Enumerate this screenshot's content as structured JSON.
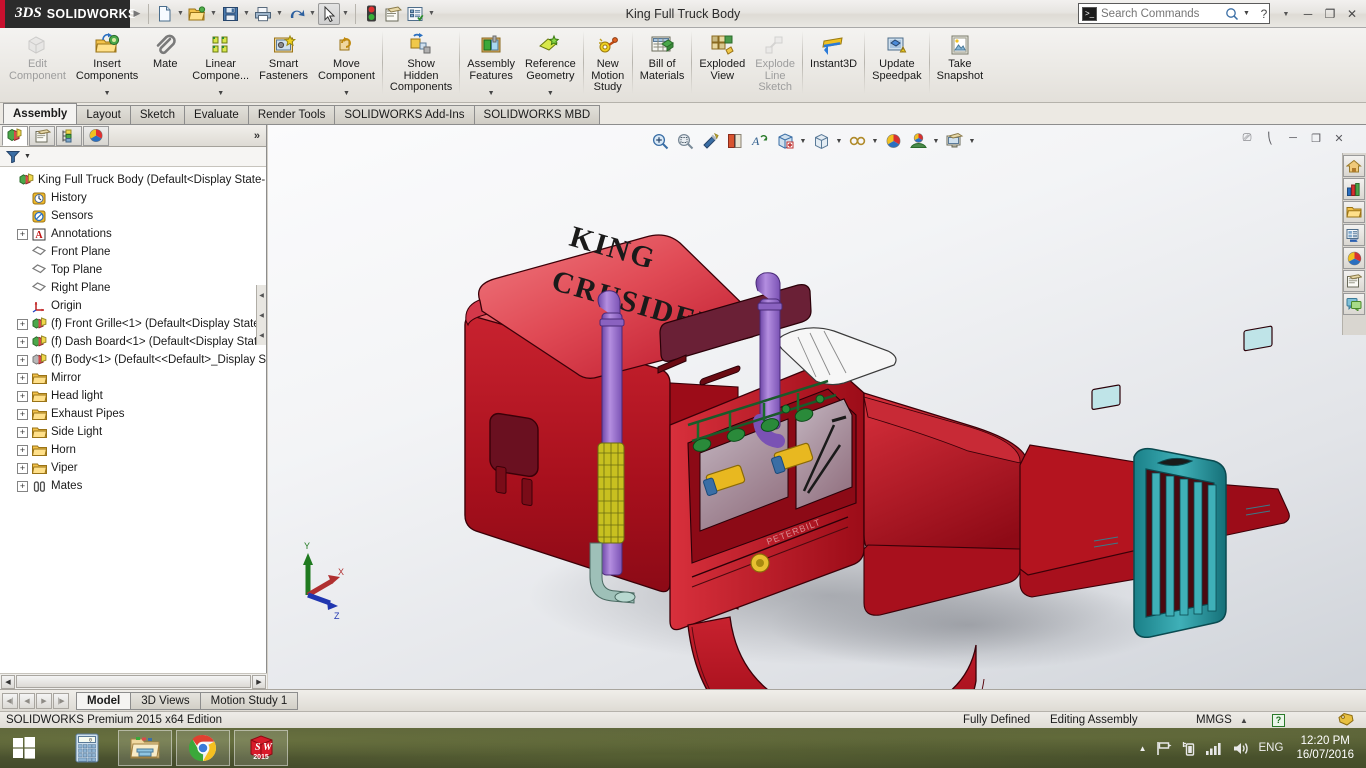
{
  "titlebar": {
    "brand_ds": "3DS",
    "brand_name": "SOLIDWORKS",
    "document_title": "King Full Truck Body",
    "quick_access": [
      {
        "name": "new-document-button",
        "icon": "new-document-icon",
        "dropdown": true
      },
      {
        "name": "open-document-button",
        "icon": "open-folder-icon",
        "dropdown": true
      },
      {
        "name": "save-button",
        "icon": "save-floppy-icon",
        "dropdown": true
      },
      {
        "name": "print-button",
        "icon": "printer-icon",
        "dropdown": true
      },
      {
        "name": "undo-button",
        "icon": "undo-arrow-icon",
        "dropdown": true
      },
      {
        "name": "select-button",
        "icon": "cursor-arrow-icon",
        "dropdown": true
      },
      {
        "name": "rebuild-button",
        "icon": "traffic-light-icon",
        "dropdown": false
      },
      {
        "name": "file-properties-button",
        "icon": "properties-icon",
        "dropdown": false
      },
      {
        "name": "options-button",
        "icon": "options-list-icon",
        "dropdown": true
      }
    ],
    "search": {
      "placeholder": "Search Commands",
      "value": ""
    },
    "help_label": "?",
    "window_controls": [
      "minimize",
      "restore",
      "close"
    ]
  },
  "ribbon": {
    "groups": [
      {
        "buttons": [
          {
            "label": "Edit\nComponent",
            "name": "edit-component-button",
            "icon": "edit-component-icon",
            "disabled": true,
            "dropdown": false
          },
          {
            "label": "Insert\nComponents",
            "name": "insert-components-button",
            "icon": "insert-components-icon",
            "disabled": false,
            "dropdown": true
          },
          {
            "label": "Mate",
            "name": "mate-button",
            "icon": "mate-paperclip-icon",
            "disabled": false,
            "dropdown": false
          },
          {
            "label": "Linear\nCompone...",
            "name": "linear-component-pattern-button",
            "icon": "linear-pattern-icon",
            "disabled": false,
            "dropdown": true
          },
          {
            "label": "Smart\nFasteners",
            "name": "smart-fasteners-button",
            "icon": "smart-fasteners-icon",
            "disabled": false,
            "dropdown": false
          },
          {
            "label": "Move\nComponent",
            "name": "move-component-button",
            "icon": "move-component-icon",
            "disabled": false,
            "dropdown": true
          }
        ]
      },
      {
        "buttons": [
          {
            "label": "Show\nHidden\nComponents",
            "name": "show-hidden-components-button",
            "icon": "show-hidden-icon",
            "disabled": false,
            "dropdown": false
          }
        ]
      },
      {
        "buttons": [
          {
            "label": "Assembly\nFeatures",
            "name": "assembly-features-button",
            "icon": "assembly-features-icon",
            "disabled": false,
            "dropdown": true
          },
          {
            "label": "Reference\nGeometry",
            "name": "reference-geometry-button",
            "icon": "reference-geometry-icon",
            "disabled": false,
            "dropdown": true
          }
        ]
      },
      {
        "buttons": [
          {
            "label": "New\nMotion\nStudy",
            "name": "new-motion-study-button",
            "icon": "motion-study-icon",
            "disabled": false,
            "dropdown": false
          }
        ]
      },
      {
        "buttons": [
          {
            "label": "Bill of\nMaterials",
            "name": "bill-of-materials-button",
            "icon": "bill-of-materials-icon",
            "disabled": false,
            "dropdown": false
          }
        ]
      },
      {
        "buttons": [
          {
            "label": "Exploded\nView",
            "name": "exploded-view-button",
            "icon": "exploded-view-icon",
            "disabled": false,
            "dropdown": false
          },
          {
            "label": "Explode\nLine\nSketch",
            "name": "explode-line-sketch-button",
            "icon": "explode-line-sketch-icon",
            "disabled": true,
            "dropdown": false
          }
        ]
      },
      {
        "buttons": [
          {
            "label": "Instant3D",
            "name": "instant3d-button",
            "icon": "instant3d-icon",
            "disabled": false,
            "dropdown": false
          }
        ]
      },
      {
        "buttons": [
          {
            "label": "Update\nSpeedpak",
            "name": "update-speedpak-button",
            "icon": "update-speedpak-icon",
            "disabled": false,
            "dropdown": false
          }
        ]
      },
      {
        "buttons": [
          {
            "label": "Take\nSnapshot",
            "name": "take-snapshot-button",
            "icon": "take-snapshot-icon",
            "disabled": false,
            "dropdown": false
          }
        ]
      }
    ]
  },
  "command_tabs": [
    {
      "label": "Assembly",
      "active": true
    },
    {
      "label": "Layout",
      "active": false
    },
    {
      "label": "Sketch",
      "active": false
    },
    {
      "label": "Evaluate",
      "active": false
    },
    {
      "label": "Render Tools",
      "active": false
    },
    {
      "label": "SOLIDWORKS Add-Ins",
      "active": false
    },
    {
      "label": "SOLIDWORKS MBD",
      "active": false
    }
  ],
  "feature_manager": {
    "tabs": [
      {
        "name": "feature-manager-tab",
        "icon": "feature-tree-icon",
        "active": true
      },
      {
        "name": "property-manager-tab",
        "icon": "property-manager-icon",
        "active": false
      },
      {
        "name": "configuration-manager-tab",
        "icon": "configuration-manager-icon",
        "active": false
      },
      {
        "name": "display-manager-tab",
        "icon": "display-manager-icon",
        "active": false
      }
    ],
    "overflow_label": "»",
    "filter_placeholder": "",
    "tree": [
      {
        "label": "King Full Truck Body  (Default<Display State-1",
        "indent": 0,
        "expander": "none",
        "icon": "assembly-icon"
      },
      {
        "label": "History",
        "indent": 1,
        "expander": "none",
        "icon": "history-clock-icon"
      },
      {
        "label": "Sensors",
        "indent": 1,
        "expander": "none",
        "icon": "sensors-icon"
      },
      {
        "label": "Annotations",
        "indent": 1,
        "expander": "plus",
        "icon": "annotations-a-icon"
      },
      {
        "label": "Front Plane",
        "indent": 1,
        "expander": "none",
        "icon": "plane-icon"
      },
      {
        "label": "Top Plane",
        "indent": 1,
        "expander": "none",
        "icon": "plane-icon"
      },
      {
        "label": "Right Plane",
        "indent": 1,
        "expander": "none",
        "icon": "plane-icon"
      },
      {
        "label": "Origin",
        "indent": 1,
        "expander": "none",
        "icon": "origin-icon"
      },
      {
        "label": "(f) Front Grille<1>  (Default<Display State-",
        "indent": 1,
        "expander": "plus",
        "icon": "part-icon"
      },
      {
        "label": "(f) Dash Board<1>  (Default<Display State-",
        "indent": 1,
        "expander": "plus",
        "icon": "part-icon"
      },
      {
        "label": "(f) Body<1>  (Default<<Default>_Display S",
        "indent": 1,
        "expander": "plus",
        "icon": "part-gray-icon"
      },
      {
        "label": "Mirror",
        "indent": 1,
        "expander": "plus",
        "icon": "folder-icon"
      },
      {
        "label": "Head light",
        "indent": 1,
        "expander": "plus",
        "icon": "folder-icon"
      },
      {
        "label": "Exhaust Pipes",
        "indent": 1,
        "expander": "plus",
        "icon": "folder-icon"
      },
      {
        "label": "Side Light",
        "indent": 1,
        "expander": "plus",
        "icon": "folder-icon"
      },
      {
        "label": "Horn",
        "indent": 1,
        "expander": "plus",
        "icon": "folder-icon"
      },
      {
        "label": "Viper",
        "indent": 1,
        "expander": "plus",
        "icon": "folder-icon"
      },
      {
        "label": "Mates",
        "indent": 1,
        "expander": "plus",
        "icon": "mates-icon"
      }
    ]
  },
  "view_toolbar": [
    {
      "name": "zoom-to-fit-button",
      "icon": "zoom-to-fit-icon",
      "dropdown": false
    },
    {
      "name": "zoom-to-area-button",
      "icon": "zoom-to-area-icon",
      "dropdown": false
    },
    {
      "name": "previous-view-button",
      "icon": "previous-view-icon",
      "dropdown": false
    },
    {
      "name": "section-view-button",
      "icon": "section-view-icon",
      "dropdown": false
    },
    {
      "name": "view-orientation-button",
      "icon": "view-orientation-icon",
      "dropdown": false
    },
    {
      "name": "display-style-button",
      "icon": "display-style-icon",
      "dropdown": true
    },
    {
      "name": "hide-show-items-button",
      "icon": "hide-show-items-icon",
      "dropdown": true
    },
    {
      "name": "edit-appearance-button",
      "icon": "edit-appearance-icon",
      "dropdown": false
    },
    {
      "name": "apply-scene-button",
      "icon": "apply-scene-icon",
      "dropdown": true
    },
    {
      "name": "view-settings-button",
      "icon": "view-settings-icon",
      "dropdown": true
    }
  ],
  "graphics_window_controls": [
    "restore-panel-left",
    "restore-panel-right",
    "minimize-document",
    "restore-document",
    "close-document"
  ],
  "task_pane": [
    {
      "name": "solidworks-resources-button",
      "icon": "home-house-icon"
    },
    {
      "name": "design-library-button",
      "icon": "design-library-icon"
    },
    {
      "name": "file-explorer-button",
      "icon": "file-explorer-folder-icon"
    },
    {
      "name": "view-palette-button",
      "icon": "view-palette-icon"
    },
    {
      "name": "appearances-scenes-button",
      "icon": "appearances-sphere-icon"
    },
    {
      "name": "custom-properties-button",
      "icon": "custom-properties-icon"
    },
    {
      "name": "solidworks-forum-button",
      "icon": "forum-bubble-icon"
    }
  ],
  "model": {
    "decal_text_line1": "KING",
    "decal_text_line2": "CRUSIDER",
    "triad_axes": [
      {
        "label": "X",
        "color": "#b03030"
      },
      {
        "label": "Y",
        "color": "#1f7a1f"
      },
      {
        "label": "Z",
        "color": "#2036b0"
      }
    ],
    "colors": {
      "body_red": "#b0121f",
      "hood_light_red": "#e04a55",
      "grille_teal": "#1f8f96",
      "exhaust_purple": "#9a6fd0",
      "horn_green": "#1f7a2f",
      "horn_yellow": "#e8b820",
      "visor_white": "#f2f2f2"
    }
  },
  "document_tabs": {
    "nav_buttons": [
      "first",
      "previous",
      "next",
      "last"
    ],
    "tabs": [
      {
        "label": "Model",
        "active": true
      },
      {
        "label": "3D Views",
        "active": false
      },
      {
        "label": "Motion Study 1",
        "active": false
      }
    ]
  },
  "status_bar": {
    "edition": "SOLIDWORKS Premium 2015 x64 Edition",
    "state": "Fully Defined",
    "mode": "Editing Assembly",
    "units": "MMGS",
    "units_caret": "▲",
    "help_badge": "?",
    "tag_icon": "tag-icon"
  },
  "taskbar": {
    "start_button": "windows-start-icon",
    "apps": [
      {
        "name": "taskbar-calculator",
        "icon": "calculator-icon",
        "open": false
      },
      {
        "name": "taskbar-file-explorer",
        "icon": "file-explorer-icon",
        "open": true
      },
      {
        "name": "taskbar-chrome",
        "icon": "chrome-icon",
        "open": true
      },
      {
        "name": "taskbar-solidworks",
        "icon": "solidworks-2015-icon",
        "open": true,
        "badge": "2015"
      }
    ],
    "tray": {
      "show_hidden": "▲",
      "icons": [
        "flag-notification-icon",
        "network-icon",
        "signal-bars-icon",
        "volume-icon"
      ],
      "language": "ENG",
      "time": "12:20 PM",
      "date": "16/07/2016"
    }
  }
}
